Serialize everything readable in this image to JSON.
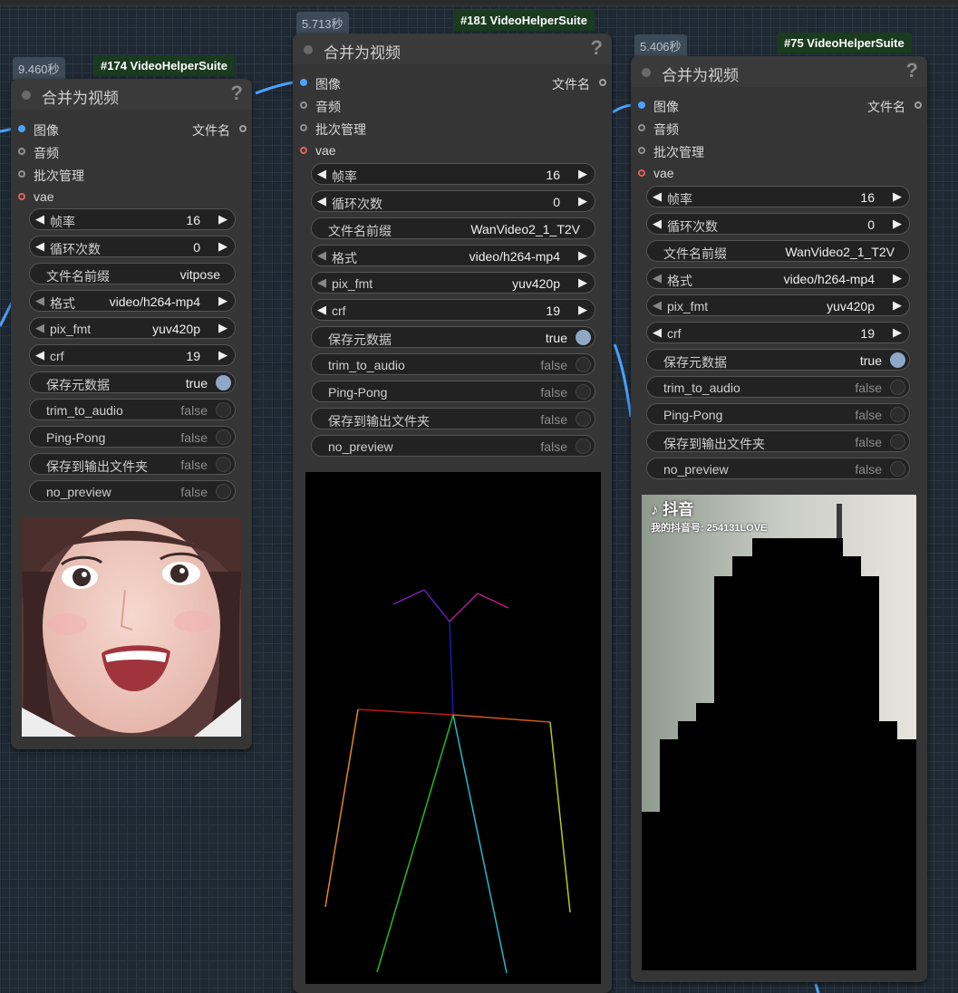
{
  "nodes": [
    {
      "time": "9.460秒",
      "suite": "#174 VideoHelperSuite",
      "title": "合并为视频",
      "help": "?",
      "inputs": [
        "图像",
        "音频",
        "批次管理",
        "vae"
      ],
      "output": "文件名",
      "widgets": [
        {
          "label": "帧率",
          "value": "16"
        },
        {
          "label": "循环次数",
          "value": "0"
        },
        {
          "label": "文件名前缀",
          "value": "vitpose"
        },
        {
          "label": "格式",
          "value": "video/h264-mp4"
        },
        {
          "label": "pix_fmt",
          "value": "yuv420p"
        },
        {
          "label": "crf",
          "value": "19"
        },
        {
          "label": "保存元数据",
          "value": "true"
        },
        {
          "label": "trim_to_audio",
          "value": "false"
        },
        {
          "label": "Ping-Pong",
          "value": "false"
        },
        {
          "label": "保存到输出文件夹",
          "value": "false"
        },
        {
          "label": "no_preview",
          "value": "false"
        }
      ]
    },
    {
      "time": "5.713秒",
      "suite": "#181 VideoHelperSuite",
      "title": "合并为视频",
      "help": "?",
      "inputs": [
        "图像",
        "音频",
        "批次管理",
        "vae"
      ],
      "output": "文件名",
      "widgets": [
        {
          "label": "帧率",
          "value": "16"
        },
        {
          "label": "循环次数",
          "value": "0"
        },
        {
          "label": "文件名前缀",
          "value": "WanVideo2_1_T2V"
        },
        {
          "label": "格式",
          "value": "video/h264-mp4"
        },
        {
          "label": "pix_fmt",
          "value": "yuv420p"
        },
        {
          "label": "crf",
          "value": "19"
        },
        {
          "label": "保存元数据",
          "value": "true"
        },
        {
          "label": "trim_to_audio",
          "value": "false"
        },
        {
          "label": "Ping-Pong",
          "value": "false"
        },
        {
          "label": "保存到输出文件夹",
          "value": "false"
        },
        {
          "label": "no_preview",
          "value": "false"
        }
      ]
    },
    {
      "time": "5.406秒",
      "suite": "#75 VideoHelperSuite",
      "title": "合并为视频",
      "help": "?",
      "inputs": [
        "图像",
        "音频",
        "批次管理",
        "vae"
      ],
      "output": "文件名",
      "widgets": [
        {
          "label": "帧率",
          "value": "16"
        },
        {
          "label": "循环次数",
          "value": "0"
        },
        {
          "label": "文件名前缀",
          "value": "WanVideo2_1_T2V"
        },
        {
          "label": "格式",
          "value": "video/h264-mp4"
        },
        {
          "label": "pix_fmt",
          "value": "yuv420p"
        },
        {
          "label": "crf",
          "value": "19"
        },
        {
          "label": "保存元数据",
          "value": "true"
        },
        {
          "label": "trim_to_audio",
          "value": "false"
        },
        {
          "label": "Ping-Pong",
          "value": "false"
        },
        {
          "label": "保存到输出文件夹",
          "value": "false"
        },
        {
          "label": "no_preview",
          "value": "false"
        }
      ],
      "preview_overlay": {
        "app": "抖音",
        "account": "我的抖音号: 254131LOVE"
      }
    }
  ]
}
